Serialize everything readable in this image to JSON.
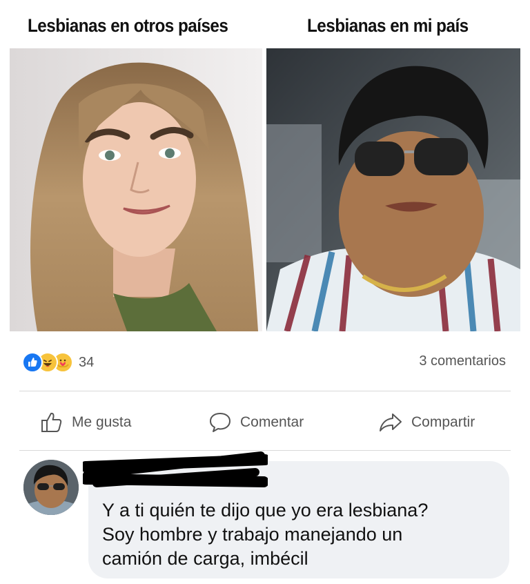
{
  "post": {
    "caption_left": "Lesbianas en otros países",
    "caption_right": "Lesbianas en mi país"
  },
  "stats": {
    "reaction_count": "34",
    "comments": "3 comentarios",
    "reaction_icons": [
      "like-icon",
      "haha-icon",
      "care-icon"
    ]
  },
  "actions": {
    "like": "Me gusta",
    "comment": "Comentar",
    "share": "Compartir"
  },
  "comment": {
    "lines": [
      "Y a ti quién te dijo que yo era lesbiana?",
      "Soy hombre y trabajo manejando un",
      "camión de carga, imbécil"
    ]
  },
  "colors": {
    "like_blue": "#1877f2",
    "bubble_bg": "#eff1f4",
    "muted_text": "#555555"
  }
}
